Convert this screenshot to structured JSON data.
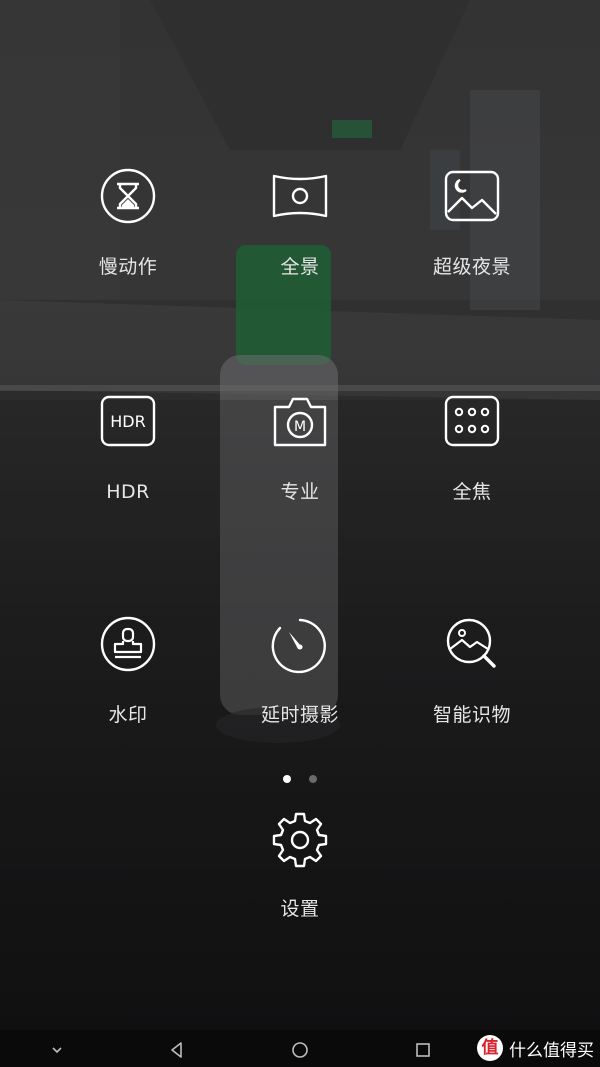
{
  "modes": [
    {
      "label": "慢动作",
      "icon": "hourglass-icon"
    },
    {
      "label": "全景",
      "icon": "panorama-icon"
    },
    {
      "label": "超级夜景",
      "icon": "night-scene-icon"
    },
    {
      "label": "HDR",
      "icon": "hdr-icon",
      "icon_text": "HDR"
    },
    {
      "label": "专业",
      "icon": "pro-camera-icon",
      "icon_text": "M"
    },
    {
      "label": "全焦",
      "icon": "all-focus-icon"
    },
    {
      "label": "水印",
      "icon": "stamp-icon"
    },
    {
      "label": "延时摄影",
      "icon": "timelapse-icon"
    },
    {
      "label": "智能识物",
      "icon": "image-search-icon"
    }
  ],
  "pager": {
    "current_page": 1,
    "total_pages": 2
  },
  "settings": {
    "label": "设置",
    "icon": "gear-icon"
  },
  "navbar": {
    "buttons": [
      "collapse-icon",
      "back-icon",
      "home-icon",
      "recents-icon"
    ]
  },
  "watermark": {
    "logo_text": "值",
    "text": "什么值得买"
  },
  "colors": {
    "icon_stroke": "#ffffff",
    "label_text": "#e6e6e6",
    "dot_active": "#ffffff",
    "dot_inactive": "#6a6a6a"
  }
}
